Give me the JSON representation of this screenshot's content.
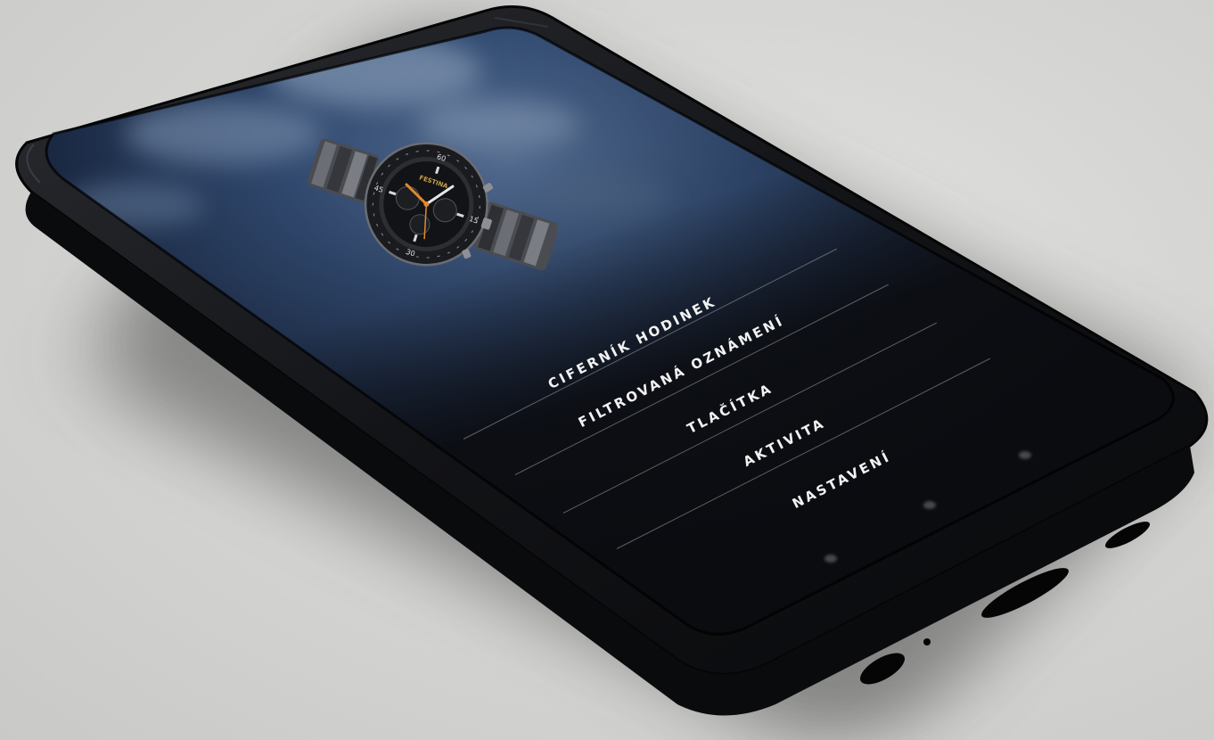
{
  "menu": {
    "items": [
      {
        "label": "CIFERNÍK HODINEK"
      },
      {
        "label": "FILTROVANÁ OZNÁMENÍ"
      },
      {
        "label": "TLAČÍTKA"
      },
      {
        "label": "AKTIVITA"
      },
      {
        "label": "NASTAVENÍ"
      }
    ]
  },
  "watch": {
    "brand": "FESTINA",
    "bezel_numbers": [
      "60",
      "15",
      "30",
      "45"
    ]
  },
  "colors": {
    "background": "#d6d6d4",
    "phone_frame": "#101114",
    "screen_dark": "#0c0d10",
    "sky_blue": "#2d4a72",
    "accent_orange": "#e08a2a",
    "menu_text": "#f2f2f2"
  }
}
